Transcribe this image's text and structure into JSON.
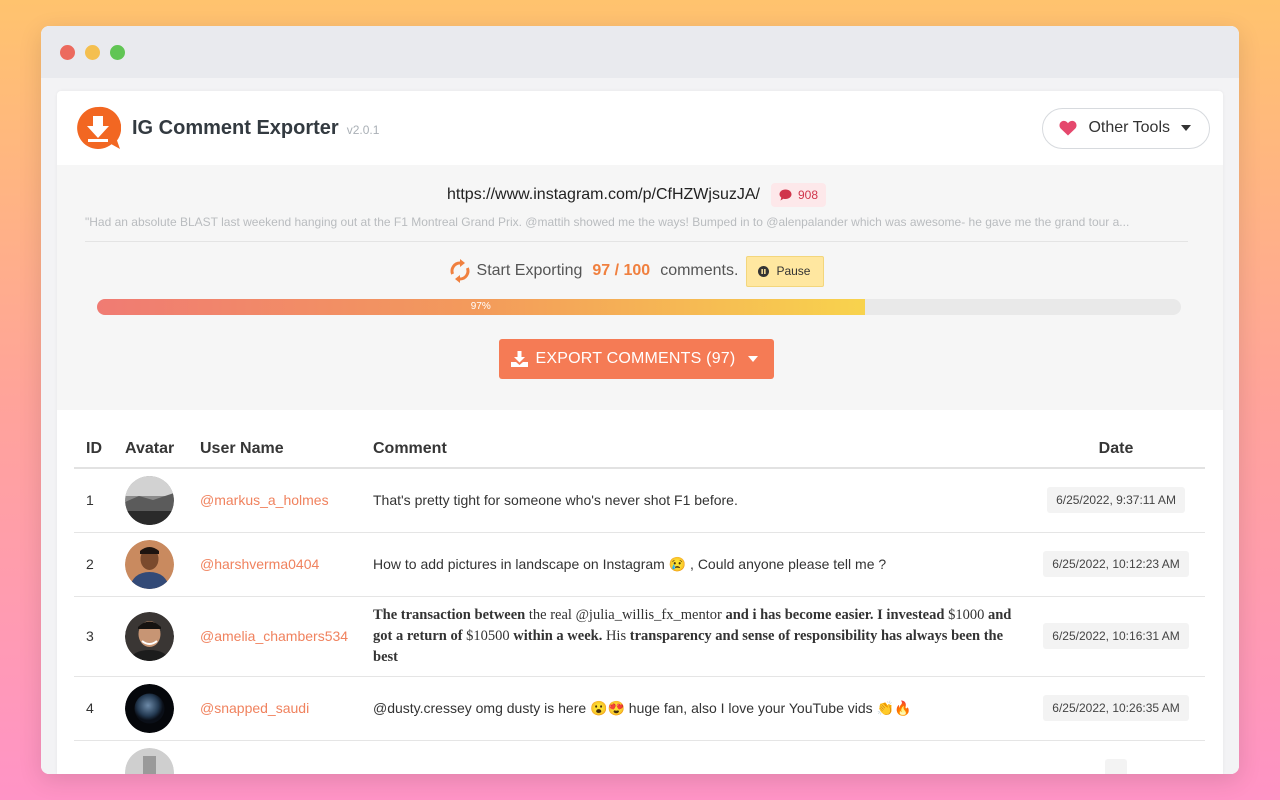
{
  "app": {
    "title": "IG Comment Exporter",
    "version": "v2.0.1",
    "other_tools_label": "Other Tools"
  },
  "post": {
    "url": "https://www.instagram.com/p/CfHZWjsuzJA/",
    "comment_count": "908",
    "caption": "\"Had an absolute BLAST last weekend hanging out at the F1 Montreal Grand Prix. @mattih showed me the ways! Bumped in to @alenpalander which was awesome- he gave me the grand tour a..."
  },
  "export_status": {
    "status_label": "Start Exporting",
    "progress_text": "97 / 100",
    "suffix": "comments.",
    "pause_label": "Pause",
    "progress_percent": 97,
    "progress_label": "97%",
    "export_button_label": "EXPORT COMMENTS (97)"
  },
  "table": {
    "headers": {
      "id": "ID",
      "avatar": "Avatar",
      "user": "User Name",
      "comment": "Comment",
      "date": "Date"
    },
    "rows": [
      {
        "id": "1",
        "user": "@markus_a_holmes",
        "comment": "That's pretty tight for someone who's never shot F1 before.",
        "date": "6/25/2022, 9:37:11 AM"
      },
      {
        "id": "2",
        "user": "@harshverma0404",
        "comment": "How to add pictures in landscape on Instagram 😢 , Could anyone please tell me ?",
        "date": "6/25/2022, 10:12:23 AM"
      },
      {
        "id": "3",
        "user": "@amelia_chambers534",
        "comment_parts": [
          "The transaction between",
          " the real @julia_willis_fx_mentor ",
          "and i has become easier. I investead",
          " $1000 ",
          "and got a return of",
          " $10500 ",
          "within a week.",
          " His ",
          "transparency and sense of responsibility has always been the best"
        ],
        "date": "6/25/2022, 10:16:31 AM"
      },
      {
        "id": "4",
        "user": "@snapped_saudi",
        "comment": "@dusty.cressey omg dusty is here 😮😍 huge fan, also I love your YouTube vids 👏🔥",
        "date": "6/25/2022, 10:26:35 AM"
      }
    ]
  },
  "colors": {
    "accent": "#f57b55",
    "username": "#f0825e",
    "badge_text": "#d0354b",
    "pause_bg": "#ffe7a0"
  }
}
